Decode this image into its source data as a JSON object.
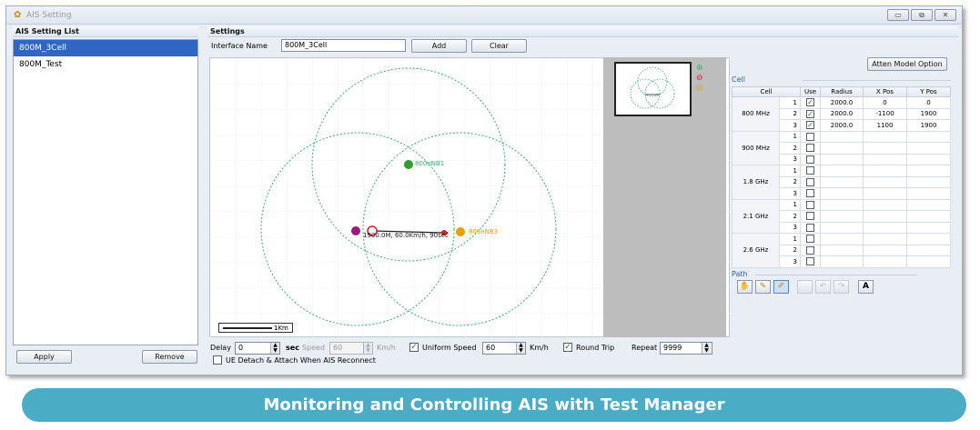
{
  "window": {
    "title": "AIS Setting",
    "controls": [
      "▭",
      "⧉",
      "✕"
    ]
  },
  "list_panel": {
    "header": "AIS Setting List",
    "items": [
      "800M_3Cell",
      "800M_Test"
    ],
    "selected_index": 0,
    "apply_label": "Apply",
    "remove_label": "Remove"
  },
  "settings": {
    "header": "Settings",
    "interface_label": "Interface Name",
    "interface_value": "800M_3Cell",
    "add_label": "Add",
    "clear_label": "Clear"
  },
  "map": {
    "enb_labels": [
      "800eNB1",
      "800eNB3"
    ],
    "path_label": "1900.0M, 60.0Km/h, 90sec",
    "scale_label": "1Km"
  },
  "controls": {
    "delay_label": "Delay",
    "delay_value": "0",
    "sec_label": "sec",
    "speed_label": "Speed",
    "speed_value": "60",
    "speed_unit": "Km/h",
    "uniform_label": "Uniform Speed",
    "uniform_checked": true,
    "uniform_value": "60",
    "uniform_unit": "Km/h",
    "round_trip_label": "Round Trip",
    "round_trip_checked": true,
    "repeat_label": "Repeat",
    "repeat_value": "9999",
    "ue_detach_label": "UE Detach & Attach When AIS Reconnect",
    "ue_detach_checked": false
  },
  "cell_panel": {
    "atten_button": "Atten Model Option",
    "section_label": "Cell",
    "columns": [
      "Cell",
      "Use",
      "Radius",
      "X Pos",
      "Y Pos"
    ],
    "bands": [
      {
        "name": "800 MHz",
        "rows": [
          {
            "n": "1",
            "use": true,
            "radius": "2000.0",
            "x": "0",
            "y": "0"
          },
          {
            "n": "2",
            "use": true,
            "radius": "2000.0",
            "x": "-1100",
            "y": "1900"
          },
          {
            "n": "3",
            "use": true,
            "radius": "2000.0",
            "x": "1100",
            "y": "1900"
          }
        ]
      },
      {
        "name": "900 MHz",
        "rows": [
          {
            "n": "1",
            "use": false,
            "radius": "",
            "x": "",
            "y": ""
          },
          {
            "n": "2",
            "use": false,
            "radius": "",
            "x": "",
            "y": ""
          },
          {
            "n": "3",
            "use": false,
            "radius": "",
            "x": "",
            "y": ""
          }
        ]
      },
      {
        "name": "1.8 GHz",
        "rows": [
          {
            "n": "1",
            "use": false,
            "radius": "",
            "x": "",
            "y": ""
          },
          {
            "n": "2",
            "use": false,
            "radius": "",
            "x": "",
            "y": ""
          },
          {
            "n": "3",
            "use": false,
            "radius": "",
            "x": "",
            "y": ""
          }
        ]
      },
      {
        "name": "2.1 GHz",
        "rows": [
          {
            "n": "1",
            "use": false,
            "radius": "",
            "x": "",
            "y": ""
          },
          {
            "n": "2",
            "use": false,
            "radius": "",
            "x": "",
            "y": ""
          },
          {
            "n": "3",
            "use": false,
            "radius": "",
            "x": "",
            "y": ""
          }
        ]
      },
      {
        "name": "2.6 GHz",
        "rows": [
          {
            "n": "1",
            "use": false,
            "radius": "",
            "x": "",
            "y": ""
          },
          {
            "n": "2",
            "use": false,
            "radius": "",
            "x": "",
            "y": ""
          },
          {
            "n": "3",
            "use": false,
            "radius": "",
            "x": "",
            "y": ""
          }
        ]
      }
    ],
    "path_label": "Path",
    "path_tools": [
      "hand-icon",
      "add-point-icon",
      "edit-point-icon",
      "blank-icon",
      "undo-icon",
      "redo-icon",
      "text-icon"
    ],
    "path_tool_text": "A"
  },
  "banner": {
    "text": "Monitoring and Controlling AIS with Test Manager"
  },
  "colors": {
    "accent": "#3266c4",
    "banner": "#4bacc6",
    "circle": "#3cb371",
    "enb1": "#2e9e2e",
    "enb3": "#e8a000",
    "ue": "#9a1a7e"
  }
}
